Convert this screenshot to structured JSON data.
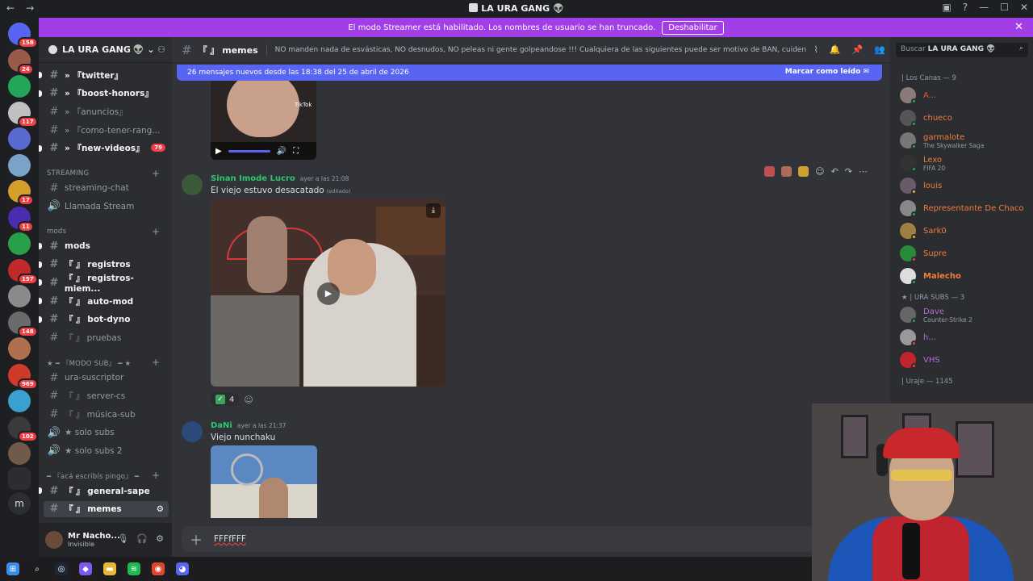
{
  "window": {
    "title": "LA URA GANG",
    "nav_back": "←",
    "nav_fwd": "→",
    "min": "—",
    "max": "☐",
    "close": "✕"
  },
  "banner": {
    "text": "El modo Streamer está habilitado. Los nombres de usuario se han truncado.",
    "button": "Deshabilitar",
    "close": "✕"
  },
  "server": {
    "name": "LA URA GANG"
  },
  "servers": [
    {
      "badge": "158",
      "color": "#5865f2"
    },
    {
      "badge": "24",
      "color": "#9a5a4a"
    },
    {
      "badge": "",
      "color": "#23a55a"
    },
    {
      "badge": "117",
      "color": "#c0c0c0"
    },
    {
      "badge": "",
      "color": "#5b6ad0"
    },
    {
      "badge": "",
      "color": "#7ba3c9"
    },
    {
      "badge": "17",
      "color": "#d4a02a"
    },
    {
      "badge": "11",
      "color": "#4b2bb0"
    },
    {
      "badge": "",
      "color": "#28a04a"
    },
    {
      "badge": "157",
      "color": "#c02a2a"
    },
    {
      "badge": "",
      "color": "#8a8a8a"
    },
    {
      "badge": "148",
      "color": "#6a6a6a"
    },
    {
      "badge": "",
      "color": "#b07050"
    },
    {
      "badge": "969",
      "color": "#d03a2a"
    },
    {
      "badge": "",
      "color": "#3aa0d0"
    },
    {
      "badge": "102",
      "color": "#3a3a3a"
    },
    {
      "badge": "",
      "color": "#705a4a"
    }
  ],
  "channels": [
    {
      "prefix": "» ",
      "label": "『twitter』",
      "icon": "bird",
      "type": "text",
      "bold": true
    },
    {
      "prefix": "» ",
      "label": "『boost-honors』",
      "icon": "heart",
      "type": "text",
      "bold": true
    },
    {
      "prefix": "» ",
      "label": "『anuncios』",
      "icon": "bell",
      "type": "text",
      "bold": false
    },
    {
      "prefix": "» ",
      "label": "『como-tener-rang...",
      "icon": "wand",
      "type": "text",
      "bold": false
    },
    {
      "prefix": "» ",
      "label": "『new-videos』",
      "icon": "tv",
      "type": "text",
      "bold": true,
      "count": "79"
    }
  ],
  "cat_streaming": "STREAMING",
  "ch_streaming": [
    {
      "label": "streaming-chat",
      "type": "text"
    },
    {
      "label": "Llamada Stream",
      "type": "voice"
    }
  ],
  "cat_mods": "mods",
  "ch_mods": [
    {
      "label": "mods",
      "bold": true
    },
    {
      "label": "『 』 registros",
      "bold": true
    },
    {
      "label": "『 』 registros-miem...",
      "bold": true
    },
    {
      "label": "『 』 auto-mod",
      "bold": true
    },
    {
      "label": "『 』 bot-dyno",
      "bold": true
    },
    {
      "label": "『 』 pruebas",
      "bold": false
    }
  ],
  "cat_sub": "★ ━ 『MODO SUB』 ━ ★",
  "ch_sub": [
    {
      "label": "ura-suscriptor",
      "type": "text"
    },
    {
      "label": "『 』 server-cs",
      "type": "text"
    },
    {
      "label": "『 』 música-sub",
      "type": "text"
    },
    {
      "label": "★ solo subs",
      "type": "voice"
    },
    {
      "label": "★ solo subs 2",
      "type": "voice"
    }
  ],
  "cat_aca": "━ 『acá escribís pingo』 ━",
  "ch_aca": [
    {
      "label": "『 』 general-sape",
      "bold": true
    },
    {
      "label": "『 』 memes",
      "selected": true
    }
  ],
  "user": {
    "name": "Mr Nacho...",
    "status": "Invisible"
  },
  "channel_header": {
    "name": "『 』 memes",
    "topic": "NO manden nada de esvásticas, NO desnudos, NO peleas ni gente golpeandose !!! Cualquiera de las siguientes puede ser motivo de BAN, cuiden el stream!"
  },
  "new_messages": {
    "text": "26 mensajes nuevos desde las 18:38 del 25 de abril de 2026",
    "mark": "Marcar como leído"
  },
  "video1": {
    "watermark": "TikTok"
  },
  "messages": [
    {
      "author": "Sinan Imode Lucro",
      "time": "ayer a las 21:08",
      "text": "El viejo estuvo desacatado",
      "edited": "(editado)",
      "color": "#2dc770",
      "reaction_count": "4"
    },
    {
      "author": "DaNi",
      "time": "ayer a las 21:37",
      "text": "Viejo nunchaku",
      "color": "#2dc770"
    }
  ],
  "input": {
    "value": "FFFfFFF"
  },
  "search": {
    "placeholder": "Buscar",
    "server": "LA URA GANG"
  },
  "members": {
    "groups": [
      {
        "title": "| Los Canas — 9",
        "items": [
          {
            "name": "A...",
            "activity": "",
            "color": "#e8542c",
            "status": "#23a55a",
            "avatar": "#8a7a7a"
          },
          {
            "name": "chueco",
            "activity": "",
            "color": "#f47b3a",
            "status": "#23a55a",
            "avatar": "#555"
          },
          {
            "name": "garmalote",
            "activity": "The Skywalker Saga",
            "color": "#f47b3a",
            "status": "#23a55a",
            "avatar": "#777"
          },
          {
            "name": "Lexo",
            "activity": "FIFA 20",
            "color": "#f47b3a",
            "status": "#23a55a",
            "avatar": "#333"
          },
          {
            "name": "louis",
            "activity": "",
            "color": "#f47b3a",
            "status": "#f0b232",
            "avatar": "#6a5a6a"
          },
          {
            "name": "Representante De Chaco",
            "activity": "",
            "color": "#f47b3a",
            "status": "#23a55a",
            "avatar": "#888"
          },
          {
            "name": "Sark0",
            "activity": "",
            "color": "#f47b3a",
            "status": "#f0b232",
            "avatar": "#a08040"
          },
          {
            "name": "Supre",
            "activity": "",
            "color": "#f47b3a",
            "status": "#f23f43",
            "avatar": "#2a8a3a"
          },
          {
            "name": "Malecho",
            "activity": "",
            "color": "#f47b3a",
            "status": "#23a55a",
            "avatar": "#ddd"
          }
        ]
      },
      {
        "title": "★ | URA SUBS — 3",
        "items": [
          {
            "name": "Dave",
            "activity": "Counter-Strike 2",
            "color": "#b36bd9",
            "status": "#23a55a",
            "avatar": "#666"
          },
          {
            "name": "h...",
            "activity": "",
            "color": "#b36bd9",
            "status": "#f23f43",
            "avatar": "#999"
          },
          {
            "name": "VHS",
            "activity": "",
            "color": "#b36bd9",
            "status": "#f23f43",
            "avatar": "#c0242e"
          }
        ]
      },
      {
        "title": "| Uraje — 1145",
        "items": []
      }
    ]
  },
  "taskbar": {
    "items": [
      "windows-logo",
      "search-icon",
      "steam",
      "copilot",
      "explorer",
      "spotify",
      "chrome",
      "discord"
    ]
  }
}
